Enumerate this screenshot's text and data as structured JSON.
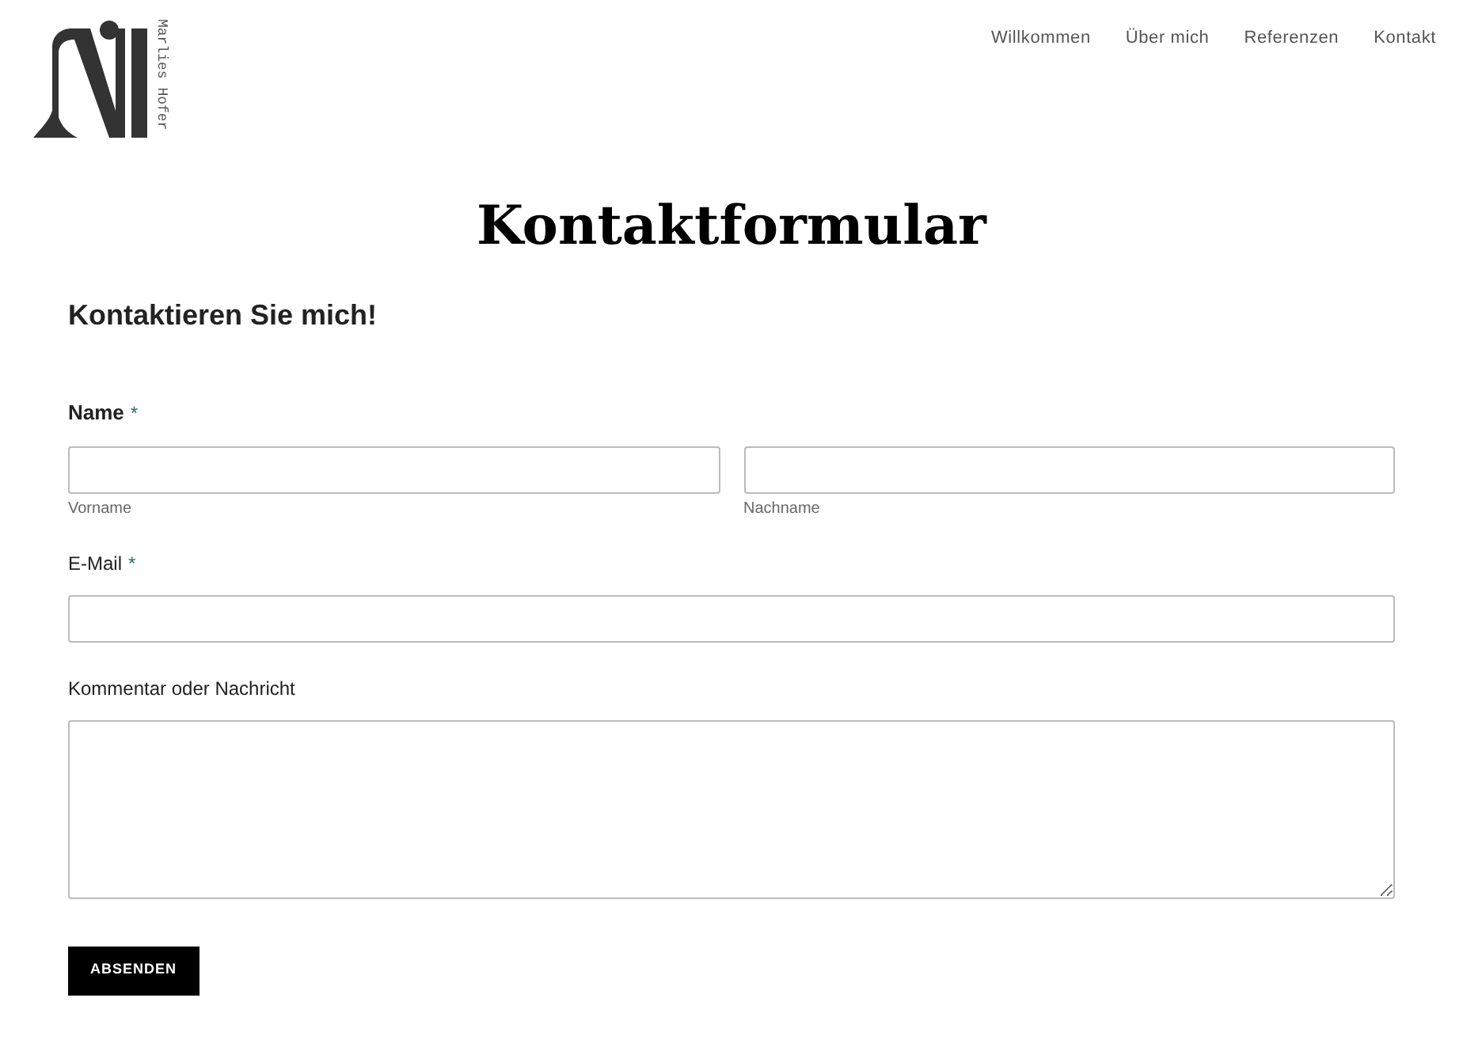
{
  "logo": {
    "text": "Marlies Hofer"
  },
  "nav": [
    {
      "label": "Willkommen"
    },
    {
      "label": "Über mich"
    },
    {
      "label": "Referenzen"
    },
    {
      "label": "Kontakt"
    }
  ],
  "page_title": "Kontaktformular",
  "form": {
    "heading": "Kontaktieren Sie mich!",
    "fields": [
      {
        "kind": "name",
        "label": "Name",
        "required_mark": "*",
        "sublabels": [
          "Vorname",
          "Nachname"
        ]
      },
      {
        "kind": "text",
        "label": "E-Mail",
        "required_mark": "*"
      },
      {
        "kind": "textarea",
        "label": "Kommentar oder Nachricht"
      }
    ],
    "submit": "ABSENDEN"
  }
}
